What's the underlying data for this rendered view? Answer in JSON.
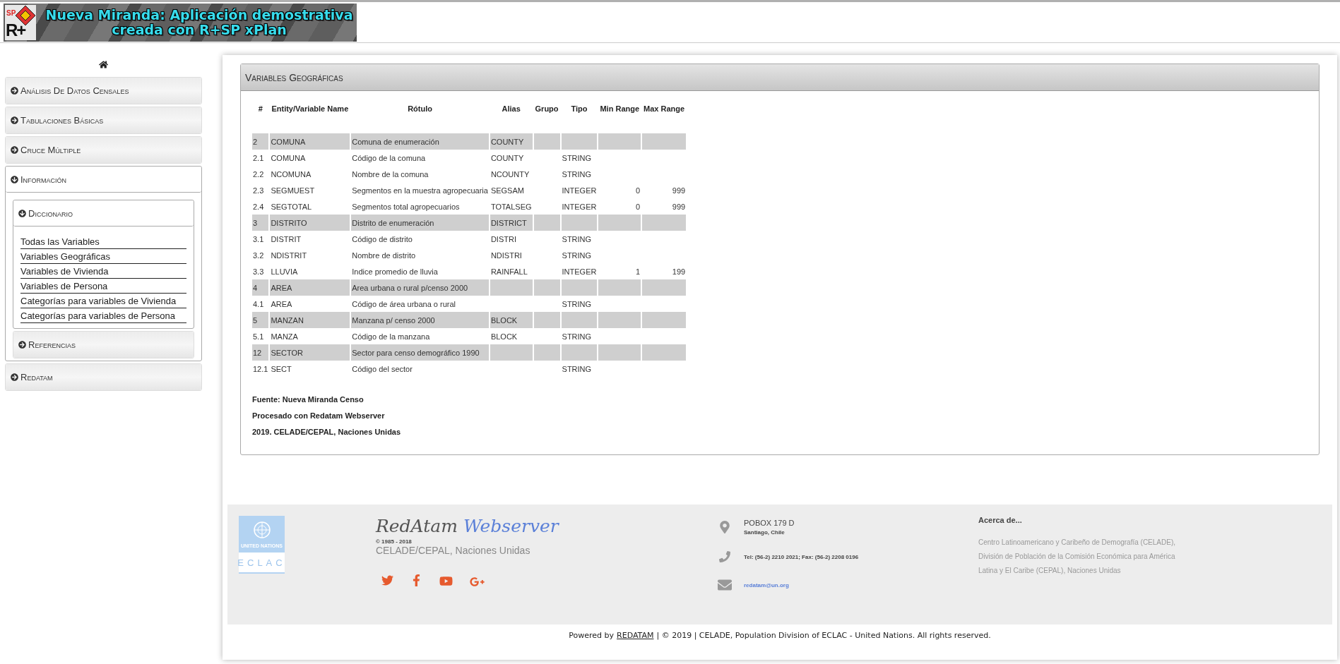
{
  "banner": {
    "logo_top": "SP",
    "logo_bottom": "R+",
    "title_lines": [
      "Nueva Miranda: Aplicación demostrativa",
      "creada con R+SP xPlan"
    ]
  },
  "sidebar": {
    "menu": [
      {
        "label": "Análisis De Datos Censales",
        "expanded": false
      },
      {
        "label": "Tabulaciones Básicas",
        "expanded": false
      },
      {
        "label": "Cruce Múltiple",
        "expanded": false
      },
      {
        "label": "Información",
        "expanded": true,
        "children": [
          {
            "label": "Diccionario",
            "expanded": true,
            "links": [
              "Todas las Variables",
              "Variables Geográficas",
              "Variables de Vivienda",
              "Variables de Persona",
              "Categorías para variables de Vivienda",
              "Categorías para variables de Persona"
            ]
          },
          {
            "label": "Referencias",
            "expanded": false
          }
        ]
      },
      {
        "label": "Redatam",
        "expanded": false
      }
    ]
  },
  "panel": {
    "title": "Variables Geográficas",
    "table": {
      "columns": [
        "#",
        "Entity/Variable Name",
        "Rótulo",
        "Alias",
        "Grupo",
        "Tipo",
        "Min Range",
        "Max Range"
      ],
      "rows": [
        {
          "kind": "entity",
          "cells": [
            "2",
            "COMUNA",
            "Comuna de enumeración",
            "COUNTY",
            "",
            "",
            "",
            ""
          ]
        },
        {
          "kind": "variable",
          "cells": [
            "2.1",
            "COMUNA",
            "Código de la comuna",
            "COUNTY",
            "",
            "STRING",
            "",
            ""
          ]
        },
        {
          "kind": "variable",
          "cells": [
            "2.2",
            "NCOMUNA",
            "Nombre de la comuna",
            "NCOUNTY",
            "",
            "STRING",
            "",
            ""
          ]
        },
        {
          "kind": "variable",
          "cells": [
            "2.3",
            "SEGMUEST",
            "Segmentos en la muestra agropecuaria",
            "SEGSAM",
            "",
            "INTEGER",
            "0",
            "999"
          ]
        },
        {
          "kind": "variable",
          "cells": [
            "2.4",
            "SEGTOTAL",
            "Segmentos total agropecuarios",
            "TOTALSEG",
            "",
            "INTEGER",
            "0",
            "999"
          ]
        },
        {
          "kind": "entity",
          "cells": [
            "3",
            "DISTRITO",
            "Distrito de enumeración",
            "DISTRICT",
            "",
            "",
            "",
            ""
          ]
        },
        {
          "kind": "variable",
          "cells": [
            "3.1",
            "DISTRIT",
            "Código de distrito",
            "DISTRI",
            "",
            "STRING",
            "",
            ""
          ]
        },
        {
          "kind": "variable",
          "cells": [
            "3.2",
            "NDISTRIT",
            "Nombre de distrito",
            "NDISTRI",
            "",
            "STRING",
            "",
            ""
          ]
        },
        {
          "kind": "variable",
          "cells": [
            "3.3",
            "LLUVIA",
            "Indice promedio de lluvia",
            "RAINFALL",
            "",
            "INTEGER",
            "1",
            "199"
          ]
        },
        {
          "kind": "entity",
          "cells": [
            "4",
            "AREA",
            "Area urbana o rural p/censo 2000",
            "",
            "",
            "",
            "",
            ""
          ]
        },
        {
          "kind": "variable",
          "cells": [
            "4.1",
            "AREA",
            "Código de área urbana o rural",
            "",
            "",
            "STRING",
            "",
            ""
          ]
        },
        {
          "kind": "entity",
          "cells": [
            "5",
            "MANZAN",
            "Manzana p/ censo 2000",
            "BLOCK",
            "",
            "",
            "",
            ""
          ]
        },
        {
          "kind": "variable",
          "cells": [
            "5.1",
            "MANZA",
            "Código de la manzana",
            "BLOCK",
            "",
            "STRING",
            "",
            ""
          ]
        },
        {
          "kind": "entity",
          "cells": [
            "12",
            "SECTOR",
            "Sector para censo demográfico 1990",
            "",
            "",
            "",
            "",
            ""
          ]
        },
        {
          "kind": "variable",
          "cells": [
            "12.1",
            "SECT",
            "Código del sector",
            "",
            "",
            "STRING",
            "",
            ""
          ]
        }
      ]
    },
    "notes": [
      "Fuente: Nueva Miranda Censo",
      "Procesado con Redatam Webserver",
      "2019. CELADE/CEPAL, Naciones Unidas"
    ]
  },
  "footer": {
    "logo_top": "UNITED NATIONS",
    "logo_bottom": "ECLAC",
    "brand_first": "RedAtam",
    "brand_second": "Webserver",
    "years": "© 1985 - 2018",
    "org": "CELADE/CEPAL, Naciones Unidas",
    "address": "POBOX 179 D",
    "city": "Santiago, Chile",
    "phone": "Tel: (56-2) 2210 2021; Fax: (56-2) 2208 0196",
    "email": "redatam@un.org",
    "about_title": "Acerca de...",
    "about_lines": [
      "Centro Latinoamericano y Caribeño de Demografía (CELADE),",
      "División de Población de la Comisión Económica para América",
      "Latina y El Caribe (CEPAL), Naciones Unidas"
    ],
    "powered_prefix": "Powered by",
    "powered_link": "REDATAM",
    "powered_suffix": "| © 2019 | CELADE, Population Division of ECLAC - United Nations. All rights reserved."
  }
}
